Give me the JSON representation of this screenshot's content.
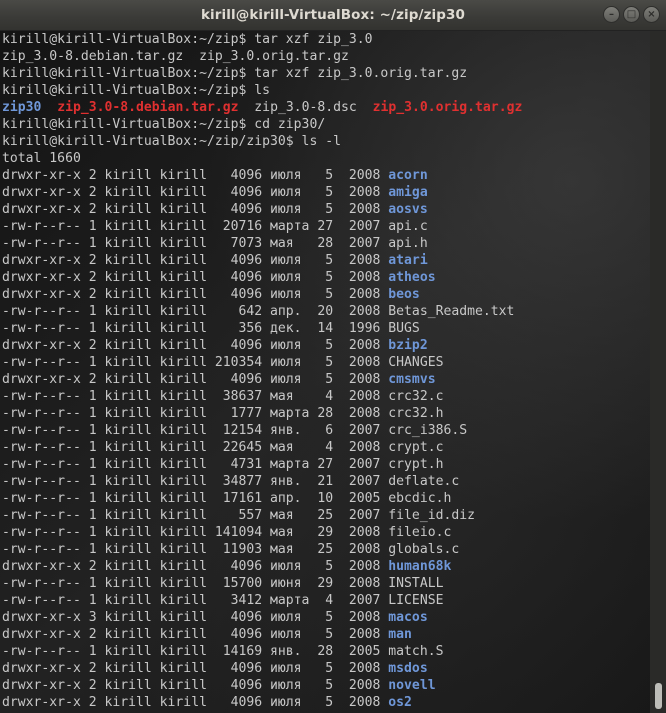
{
  "window": {
    "title": "kirill@kirill-VirtualBox: ~/zip/zip30",
    "controls": {
      "minimize": "–",
      "maximize": "□",
      "close": "×"
    }
  },
  "colors": {
    "directory": "#6f97d8",
    "archive": "#e03030",
    "text": "#c8c8c8"
  },
  "terminal": {
    "lines": [
      "kirill@kirill-VirtualBox:~/zip$ tar xzf zip_3.0",
      "zip_3.0-8.debian.tar.gz  zip_3.0.orig.tar.gz",
      "kirill@kirill-VirtualBox:~/zip$ tar xzf zip_3.0.orig.tar.gz",
      "kirill@kirill-VirtualBox:~/zip$ ls",
      "ls_output",
      "kirill@kirill-VirtualBox:~/zip$ cd zip30/",
      "kirill@kirill-VirtualBox:~/zip/zip30$ ls -l",
      "total 1660"
    ],
    "ls_output": [
      {
        "name": "zip30",
        "type": "dir"
      },
      {
        "name": "zip_3.0-8.debian.tar.gz",
        "type": "archive"
      },
      {
        "name": "zip_3.0-8.dsc",
        "type": "file"
      },
      {
        "name": "zip_3.0.orig.tar.gz",
        "type": "archive"
      }
    ],
    "listing": [
      {
        "perm": "drwxr-xr-x",
        "links": "2",
        "user": "kirill",
        "group": "kirill",
        "size": "4096",
        "month": "июля",
        "day": "5",
        "year": "2008",
        "name": "acorn",
        "type": "dir"
      },
      {
        "perm": "drwxr-xr-x",
        "links": "2",
        "user": "kirill",
        "group": "kirill",
        "size": "4096",
        "month": "июля",
        "day": "5",
        "year": "2008",
        "name": "amiga",
        "type": "dir"
      },
      {
        "perm": "drwxr-xr-x",
        "links": "2",
        "user": "kirill",
        "group": "kirill",
        "size": "4096",
        "month": "июля",
        "day": "5",
        "year": "2008",
        "name": "aosvs",
        "type": "dir"
      },
      {
        "perm": "-rw-r--r--",
        "links": "1",
        "user": "kirill",
        "group": "kirill",
        "size": "20716",
        "month": "марта",
        "day": "27",
        "year": "2007",
        "name": "api.c",
        "type": "file"
      },
      {
        "perm": "-rw-r--r--",
        "links": "1",
        "user": "kirill",
        "group": "kirill",
        "size": "7073",
        "month": "мая",
        "day": "28",
        "year": "2007",
        "name": "api.h",
        "type": "file"
      },
      {
        "perm": "drwxr-xr-x",
        "links": "2",
        "user": "kirill",
        "group": "kirill",
        "size": "4096",
        "month": "июля",
        "day": "5",
        "year": "2008",
        "name": "atari",
        "type": "dir"
      },
      {
        "perm": "drwxr-xr-x",
        "links": "2",
        "user": "kirill",
        "group": "kirill",
        "size": "4096",
        "month": "июля",
        "day": "5",
        "year": "2008",
        "name": "atheos",
        "type": "dir"
      },
      {
        "perm": "drwxr-xr-x",
        "links": "2",
        "user": "kirill",
        "group": "kirill",
        "size": "4096",
        "month": "июля",
        "day": "5",
        "year": "2008",
        "name": "beos",
        "type": "dir"
      },
      {
        "perm": "-rw-r--r--",
        "links": "1",
        "user": "kirill",
        "group": "kirill",
        "size": "642",
        "month": "апр.",
        "day": "20",
        "year": "2008",
        "name": "Betas_Readme.txt",
        "type": "file"
      },
      {
        "perm": "-rw-r--r--",
        "links": "1",
        "user": "kirill",
        "group": "kirill",
        "size": "356",
        "month": "дек.",
        "day": "14",
        "year": "1996",
        "name": "BUGS",
        "type": "file"
      },
      {
        "perm": "drwxr-xr-x",
        "links": "2",
        "user": "kirill",
        "group": "kirill",
        "size": "4096",
        "month": "июля",
        "day": "5",
        "year": "2008",
        "name": "bzip2",
        "type": "dir"
      },
      {
        "perm": "-rw-r--r--",
        "links": "1",
        "user": "kirill",
        "group": "kirill",
        "size": "210354",
        "month": "июля",
        "day": "5",
        "year": "2008",
        "name": "CHANGES",
        "type": "file"
      },
      {
        "perm": "drwxr-xr-x",
        "links": "2",
        "user": "kirill",
        "group": "kirill",
        "size": "4096",
        "month": "июля",
        "day": "5",
        "year": "2008",
        "name": "cmsmvs",
        "type": "dir"
      },
      {
        "perm": "-rw-r--r--",
        "links": "1",
        "user": "kirill",
        "group": "kirill",
        "size": "38637",
        "month": "мая",
        "day": "4",
        "year": "2008",
        "name": "crc32.c",
        "type": "file"
      },
      {
        "perm": "-rw-r--r--",
        "links": "1",
        "user": "kirill",
        "group": "kirill",
        "size": "1777",
        "month": "марта",
        "day": "28",
        "year": "2008",
        "name": "crc32.h",
        "type": "file"
      },
      {
        "perm": "-rw-r--r--",
        "links": "1",
        "user": "kirill",
        "group": "kirill",
        "size": "12154",
        "month": "янв.",
        "day": "6",
        "year": "2007",
        "name": "crc_i386.S",
        "type": "file"
      },
      {
        "perm": "-rw-r--r--",
        "links": "1",
        "user": "kirill",
        "group": "kirill",
        "size": "22645",
        "month": "мая",
        "day": "4",
        "year": "2008",
        "name": "crypt.c",
        "type": "file"
      },
      {
        "perm": "-rw-r--r--",
        "links": "1",
        "user": "kirill",
        "group": "kirill",
        "size": "4731",
        "month": "марта",
        "day": "27",
        "year": "2007",
        "name": "crypt.h",
        "type": "file"
      },
      {
        "perm": "-rw-r--r--",
        "links": "1",
        "user": "kirill",
        "group": "kirill",
        "size": "34877",
        "month": "янв.",
        "day": "21",
        "year": "2007",
        "name": "deflate.c",
        "type": "file"
      },
      {
        "perm": "-rw-r--r--",
        "links": "1",
        "user": "kirill",
        "group": "kirill",
        "size": "17161",
        "month": "апр.",
        "day": "10",
        "year": "2005",
        "name": "ebcdic.h",
        "type": "file"
      },
      {
        "perm": "-rw-r--r--",
        "links": "1",
        "user": "kirill",
        "group": "kirill",
        "size": "557",
        "month": "мая",
        "day": "25",
        "year": "2007",
        "name": "file_id.diz",
        "type": "file"
      },
      {
        "perm": "-rw-r--r--",
        "links": "1",
        "user": "kirill",
        "group": "kirill",
        "size": "141094",
        "month": "мая",
        "day": "29",
        "year": "2008",
        "name": "fileio.c",
        "type": "file"
      },
      {
        "perm": "-rw-r--r--",
        "links": "1",
        "user": "kirill",
        "group": "kirill",
        "size": "11903",
        "month": "мая",
        "day": "25",
        "year": "2008",
        "name": "globals.c",
        "type": "file"
      },
      {
        "perm": "drwxr-xr-x",
        "links": "2",
        "user": "kirill",
        "group": "kirill",
        "size": "4096",
        "month": "июля",
        "day": "5",
        "year": "2008",
        "name": "human68k",
        "type": "dir"
      },
      {
        "perm": "-rw-r--r--",
        "links": "1",
        "user": "kirill",
        "group": "kirill",
        "size": "15700",
        "month": "июня",
        "day": "29",
        "year": "2008",
        "name": "INSTALL",
        "type": "file"
      },
      {
        "perm": "-rw-r--r--",
        "links": "1",
        "user": "kirill",
        "group": "kirill",
        "size": "3412",
        "month": "марта",
        "day": "4",
        "year": "2007",
        "name": "LICENSE",
        "type": "file"
      },
      {
        "perm": "drwxr-xr-x",
        "links": "3",
        "user": "kirill",
        "group": "kirill",
        "size": "4096",
        "month": "июля",
        "day": "5",
        "year": "2008",
        "name": "macos",
        "type": "dir"
      },
      {
        "perm": "drwxr-xr-x",
        "links": "2",
        "user": "kirill",
        "group": "kirill",
        "size": "4096",
        "month": "июля",
        "day": "5",
        "year": "2008",
        "name": "man",
        "type": "dir"
      },
      {
        "perm": "-rw-r--r--",
        "links": "1",
        "user": "kirill",
        "group": "kirill",
        "size": "14169",
        "month": "янв.",
        "day": "28",
        "year": "2005",
        "name": "match.S",
        "type": "file"
      },
      {
        "perm": "drwxr-xr-x",
        "links": "2",
        "user": "kirill",
        "group": "kirill",
        "size": "4096",
        "month": "июля",
        "day": "5",
        "year": "2008",
        "name": "msdos",
        "type": "dir"
      },
      {
        "perm": "drwxr-xr-x",
        "links": "2",
        "user": "kirill",
        "group": "kirill",
        "size": "4096",
        "month": "июля",
        "day": "5",
        "year": "2008",
        "name": "novell",
        "type": "dir"
      },
      {
        "perm": "drwxr-xr-x",
        "links": "2",
        "user": "kirill",
        "group": "kirill",
        "size": "4096",
        "month": "июля",
        "day": "5",
        "year": "2008",
        "name": "os2",
        "type": "dir"
      }
    ]
  }
}
